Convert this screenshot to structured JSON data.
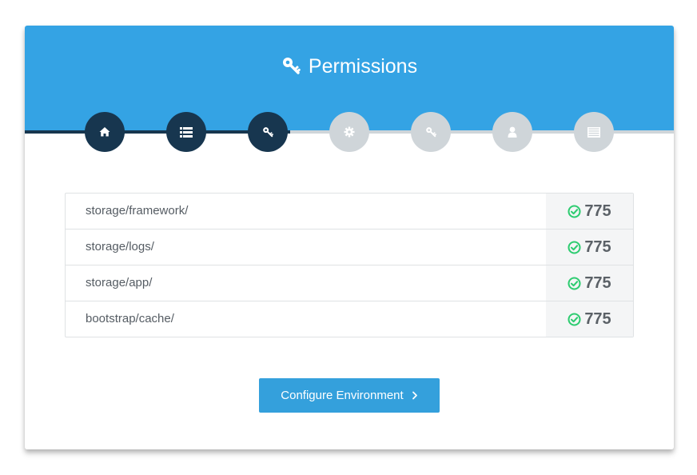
{
  "header": {
    "title": "Permissions",
    "icon": "key-icon"
  },
  "steps": [
    {
      "icon": "home-icon",
      "status": "done"
    },
    {
      "icon": "list-icon",
      "status": "done"
    },
    {
      "icon": "key-icon",
      "status": "done"
    },
    {
      "icon": "gear-icon",
      "status": "pending"
    },
    {
      "icon": "key-icon",
      "status": "pending"
    },
    {
      "icon": "user-icon",
      "status": "pending"
    },
    {
      "icon": "server-icon",
      "status": "pending"
    }
  ],
  "permissions": [
    {
      "path": "storage/framework/",
      "value": "775",
      "status": "ok"
    },
    {
      "path": "storage/logs/",
      "value": "775",
      "status": "ok"
    },
    {
      "path": "storage/app/",
      "value": "775",
      "status": "ok"
    },
    {
      "path": "bootstrap/cache/",
      "value": "775",
      "status": "ok"
    }
  ],
  "actions": {
    "next_label": "Configure Environment"
  },
  "colors": {
    "header": "#34a3e4",
    "done": "#17364f",
    "pending": "#cfd5d9",
    "ok": "#2ecc71",
    "button": "#34a0dc"
  }
}
